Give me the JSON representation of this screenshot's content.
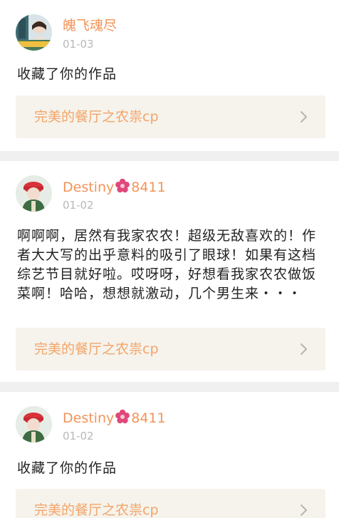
{
  "comments": [
    {
      "user": "魄飞魂尽",
      "date": "01-03",
      "message": "收藏了你的作品",
      "work": "完美的餐厅之农祟cp"
    },
    {
      "user_prefix": "Destiny",
      "user_suffix": "8411",
      "date": "01-02",
      "message": "啊啊啊，居然有我家农农！超级无敌喜欢的！作者大大写的出乎意料的吸引了眼球！如果有这档综艺节目就好啦。哎呀呀，好想看我家农农做饭菜啊！哈哈，想想就激动，几个男生来・・・",
      "work": "完美的餐厅之农祟cp"
    },
    {
      "user_prefix": "Destiny",
      "user_suffix": "8411",
      "date": "01-02",
      "message": "收藏了你的作品",
      "work": "完美的餐厅之农祟cp"
    }
  ],
  "icons": {
    "username_decoration": "flower-icon",
    "link_arrow": "chevron-right-icon"
  },
  "colors": {
    "username": "#f2945a",
    "work_title": "#f4a469",
    "date": "#b8b8b8",
    "link_background": "#f5f3ec",
    "flower": "#e0487a"
  }
}
